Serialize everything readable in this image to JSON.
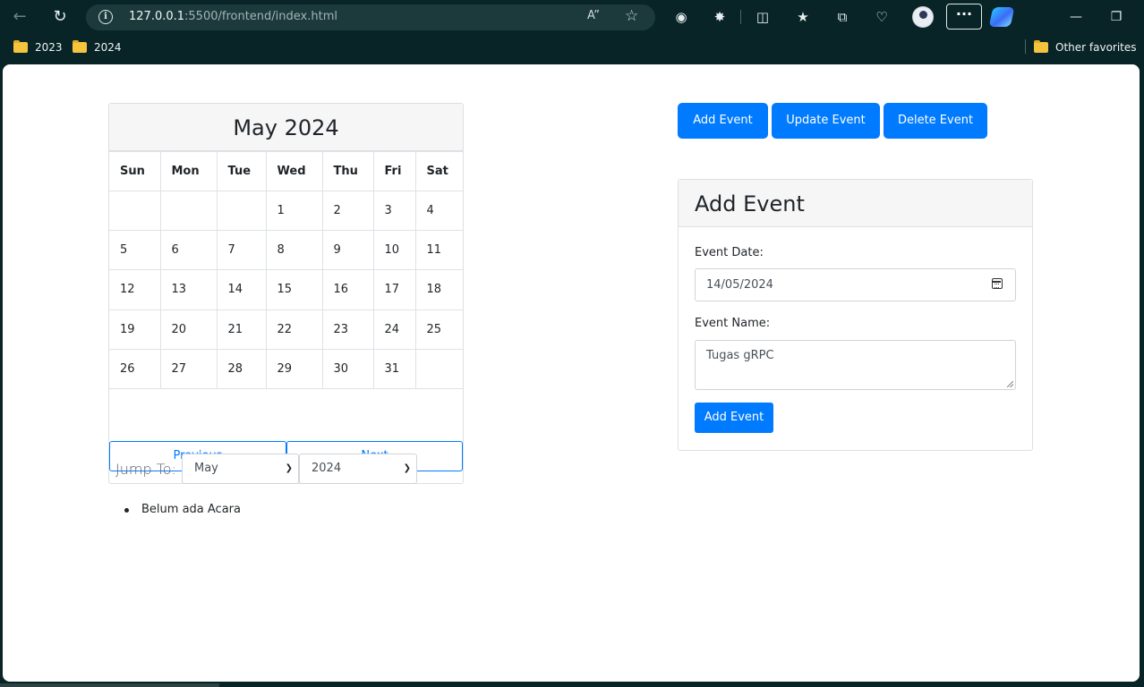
{
  "browser": {
    "url_host": "127.0.0.1",
    "url_rest": ":5500/frontend/index.html",
    "bookmarks": [
      "2023",
      "2024"
    ],
    "other_favorites": "Other favorites"
  },
  "calendar": {
    "title": "May 2024",
    "weekdays": [
      "Sun",
      "Mon",
      "Tue",
      "Wed",
      "Thu",
      "Fri",
      "Sat"
    ],
    "weeks": [
      [
        "",
        "",
        "",
        "1",
        "2",
        "3",
        "4"
      ],
      [
        "5",
        "6",
        "7",
        "8",
        "9",
        "10",
        "11"
      ],
      [
        "12",
        "13",
        "14",
        "15",
        "16",
        "17",
        "18"
      ],
      [
        "19",
        "20",
        "21",
        "22",
        "23",
        "24",
        "25"
      ],
      [
        "26",
        "27",
        "28",
        "29",
        "30",
        "31",
        ""
      ]
    ],
    "prev_label": "Previous",
    "next_label": "Next",
    "jump_label": "Jump To:",
    "month_select": "May",
    "year_select": "2024"
  },
  "events": {
    "empty_text": "Belum ada Acara"
  },
  "actions": {
    "add": "Add Event",
    "update": "Update Event",
    "delete": "Delete Event"
  },
  "form": {
    "title": "Add Event",
    "date_label": "Event Date:",
    "date_value": "14/05/2024",
    "name_label": "Event Name:",
    "name_value": "Tugas gRPC",
    "submit_label": "Add Event"
  }
}
